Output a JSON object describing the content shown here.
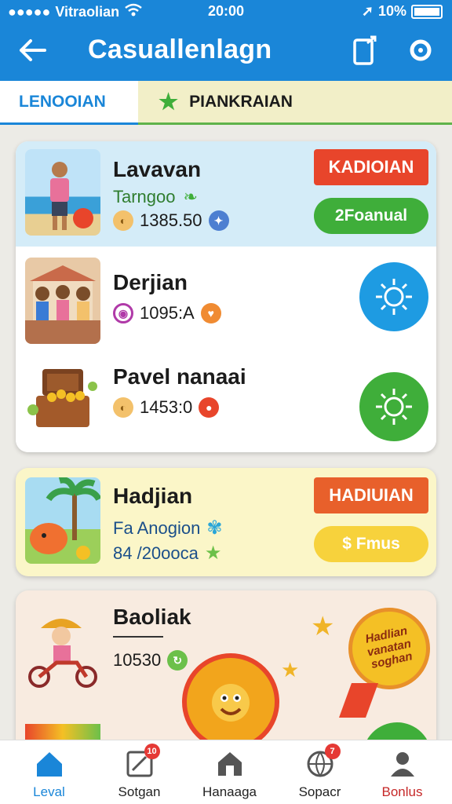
{
  "status_bar": {
    "carrier": "Vitraolian",
    "time": "20:00",
    "battery": "10%"
  },
  "header": {
    "title": "Casuallenlagn"
  },
  "tabs": [
    {
      "label": "LENOOIAN"
    },
    {
      "label": "PIANKRAIAN"
    }
  ],
  "cards": [
    {
      "name": "Lavavan",
      "sub": "Tarngoo",
      "value": "1385.50",
      "badge": "KADIOIAN",
      "action": "2Foanual"
    },
    {
      "name": "Derjian",
      "value": "1095:A"
    },
    {
      "name": "Pavel nanaai",
      "value": "1453:0"
    },
    {
      "name": "Hadjian",
      "sub": "Fa Anogion",
      "value": "84 /20ooca",
      "badge": "HADIUIAN",
      "action": "$ Fmus"
    },
    {
      "name": "Baoliak",
      "value": "10530",
      "ribbon": "Hadlian vanatan soghan"
    }
  ],
  "bottom_nav": [
    {
      "label": "Leval",
      "active": true
    },
    {
      "label": "Sotgan",
      "count": "10"
    },
    {
      "label": "Hanaaga"
    },
    {
      "label": "Sopacr",
      "count": "7"
    },
    {
      "label": "Bonlus"
    }
  ],
  "colors": {
    "primary": "#1a86d8",
    "green": "#3fae3a",
    "badge_red": "#e8452b",
    "pill_yellow": "#f7d23c"
  }
}
